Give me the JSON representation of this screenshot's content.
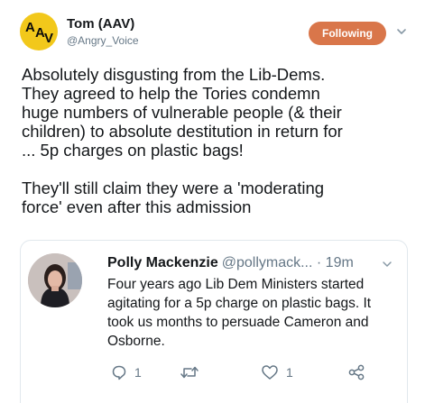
{
  "author": {
    "avatar_text": [
      "A",
      "A",
      "V"
    ],
    "name": "Tom (AAV)",
    "handle": "@Angry_Voice",
    "avatar_color": "#f2c81b"
  },
  "follow_button": {
    "label": "Following",
    "color": "#d9764a"
  },
  "tweet": {
    "text": "Absolutely disgusting from the Lib-Dems.\nThey agreed to help the Tories condemn\nhuge numbers of vulnerable people (& their\nchildren) to absolute destitution in return for\n... 5p charges on plastic bags!\n\nThey'll still claim they were a 'moderating\nforce' even after this admission"
  },
  "quoted_tweet": {
    "name": "Polly Mackenzie",
    "handle": "@pollymack...",
    "separator": "·",
    "time": "19m",
    "text": "Four years ago Lib Dem Ministers started agitating for a 5p charge on plastic bags. It took us months to persuade Cameron and Osborne.",
    "actions": {
      "reply_count": "1",
      "retweet_count": "",
      "like_count": "1"
    }
  },
  "icons": {
    "caret": "chevron-down-icon",
    "reply": "reply-icon",
    "retweet": "retweet-icon",
    "like": "heart-icon",
    "share": "share-icon"
  }
}
